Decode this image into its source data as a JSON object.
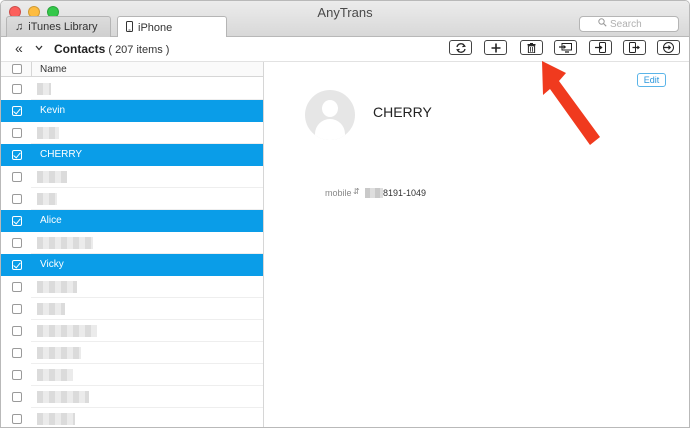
{
  "window": {
    "title": "AnyTrans",
    "controls": {
      "close": "#fc605c",
      "minimize": "#fdbc40",
      "maximize": "#34c84a"
    }
  },
  "tabs": [
    {
      "label": "iTunes Library",
      "icon": "music-note-icon",
      "active": false
    },
    {
      "label": "iPhone",
      "icon": "iphone-icon",
      "active": true
    }
  ],
  "search": {
    "placeholder": "Search"
  },
  "toolbar": {
    "title": "Contacts",
    "count": "( 207 items )",
    "buttons": [
      {
        "name": "refresh-button",
        "icon": "refresh-icon"
      },
      {
        "name": "add-button",
        "icon": "plus-icon"
      },
      {
        "name": "delete-button",
        "icon": "trash-icon"
      },
      {
        "name": "to-computer-button",
        "icon": "to-computer-icon"
      },
      {
        "name": "import-button",
        "icon": "import-icon"
      },
      {
        "name": "export-button",
        "icon": "export-icon"
      },
      {
        "name": "to-device-button",
        "icon": "to-device-icon"
      }
    ]
  },
  "list": {
    "header": {
      "name": "Name"
    },
    "rows": [
      {
        "name": "",
        "selected": false,
        "blurred": true
      },
      {
        "name": "Kevin",
        "selected": true,
        "blurred": false
      },
      {
        "name": "",
        "selected": false,
        "blurred": true
      },
      {
        "name": "CHERRY",
        "selected": true,
        "blurred": false
      },
      {
        "name": "",
        "selected": false,
        "blurred": true
      },
      {
        "name": "",
        "selected": false,
        "blurred": true
      },
      {
        "name": "Alice",
        "selected": true,
        "blurred": false
      },
      {
        "name": "",
        "selected": false,
        "blurred": true
      },
      {
        "name": "Vicky",
        "selected": true,
        "blurred": false
      },
      {
        "name": "",
        "selected": false,
        "blurred": true
      },
      {
        "name": "",
        "selected": false,
        "blurred": true
      },
      {
        "name": "",
        "selected": false,
        "blurred": true
      },
      {
        "name": "",
        "selected": false,
        "blurred": true
      },
      {
        "name": "",
        "selected": false,
        "blurred": true
      },
      {
        "name": "",
        "selected": false,
        "blurred": true
      },
      {
        "name": "",
        "selected": false,
        "blurred": true
      }
    ]
  },
  "detail": {
    "edit_label": "Edit",
    "name": "CHERRY",
    "field_label": "mobile",
    "field_value": "8191-1049"
  },
  "colors": {
    "selection": "#0a9de8",
    "accent": "#2a96dc",
    "annotation": "#f03a1e"
  }
}
